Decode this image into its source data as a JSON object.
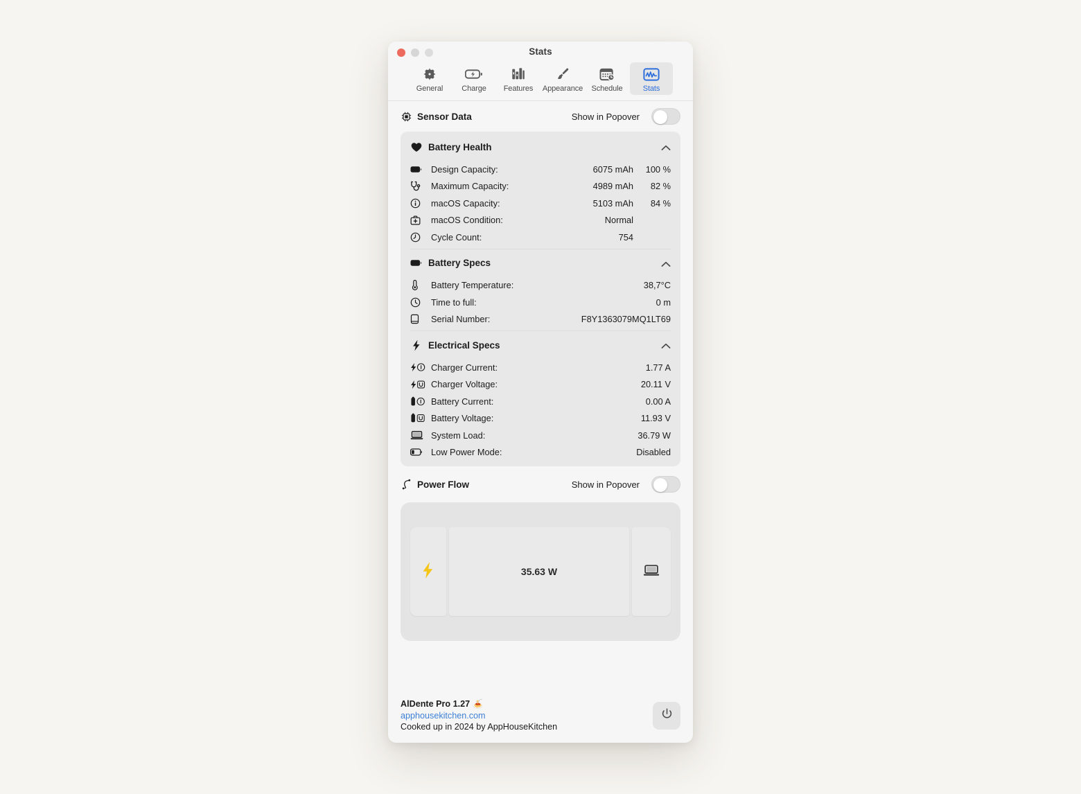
{
  "window": {
    "title": "Stats",
    "traffic_lights": [
      "close",
      "minimize",
      "zoom"
    ]
  },
  "toolbar": {
    "tabs": [
      {
        "label": "General",
        "icon": "gear-icon",
        "selected": false
      },
      {
        "label": "Charge",
        "icon": "battery-bolt-icon",
        "selected": false
      },
      {
        "label": "Features",
        "icon": "books-icon",
        "selected": false
      },
      {
        "label": "Appearance",
        "icon": "paintbrush-icon",
        "selected": false
      },
      {
        "label": "Schedule",
        "icon": "calendar-clock-icon",
        "selected": false
      },
      {
        "label": "Stats",
        "icon": "chart-waveform-icon",
        "selected": true
      }
    ],
    "accent_color": "#2f6fdd",
    "selected_tab_bg": "#e6e6e6"
  },
  "sensor_data": {
    "title": "Sensor Data",
    "icon": "chip-icon",
    "popover_label": "Show in Popover",
    "popover_enabled": false,
    "groups": [
      {
        "title": "Battery Health",
        "icon": "heart-icon",
        "expanded": true,
        "rows": [
          {
            "icon": "battery-full-icon",
            "label": "Design Capacity:",
            "value": "6075 mAh",
            "value2": "100 %"
          },
          {
            "icon": "stethoscope-icon",
            "label": "Maximum Capacity:",
            "value": "4989 mAh",
            "value2": "82 %"
          },
          {
            "icon": "info-circle-icon",
            "label": "macOS Capacity:",
            "value": "5103 mAh",
            "value2": "84 %"
          },
          {
            "icon": "first-aid-icon",
            "label": "macOS Condition:",
            "value": "Normal",
            "value2": ""
          },
          {
            "icon": "clock-icon",
            "label": "Cycle Count:",
            "value": "754",
            "value2": ""
          }
        ]
      },
      {
        "title": "Battery Specs",
        "icon": "battery-full-icon",
        "expanded": true,
        "rows": [
          {
            "icon": "thermometer-icon",
            "label": "Battery Temperature:",
            "value": "38,7°C",
            "value2": ""
          },
          {
            "icon": "clock-icon",
            "label": "Time to full:",
            "value": "0 m",
            "value2": ""
          },
          {
            "icon": "document-icon",
            "label": "Serial Number:",
            "value": "F8Y1363079MQ1LT69",
            "value2": ""
          }
        ]
      },
      {
        "title": "Electrical Specs",
        "icon": "bolt-icon",
        "expanded": true,
        "rows": [
          {
            "icon": "bolt-current-icon",
            "label": "Charger Current:",
            "value": "1.77 A",
            "value2": ""
          },
          {
            "icon": "bolt-voltage-icon",
            "label": "Charger Voltage:",
            "value": "20.11 V",
            "value2": ""
          },
          {
            "icon": "battery-current-icon",
            "label": "Battery Current:",
            "value": "0.00 A",
            "value2": ""
          },
          {
            "icon": "battery-voltage-icon",
            "label": "Battery Voltage:",
            "value": "11.93 V",
            "value2": ""
          },
          {
            "icon": "laptop-icon",
            "label": "System Load:",
            "value": "36.79 W",
            "value2": ""
          },
          {
            "icon": "battery-low-icon",
            "label": "Low Power Mode:",
            "value": "Disabled",
            "value2": ""
          }
        ]
      }
    ]
  },
  "power_flow": {
    "title": "Power Flow",
    "icon": "flow-path-icon",
    "popover_label": "Show in Popover",
    "popover_enabled": false,
    "source_icon": "lightning-bolt-icon",
    "source_icon_color": "#f5c518",
    "wattage": "35.63 W",
    "target_icon": "laptop-icon"
  },
  "footer": {
    "app_title": "AlDente Pro 1.27",
    "app_emoji": "🍝",
    "link": "apphousekitchen.com",
    "credit": "Cooked up in 2024 by AppHouseKitchen",
    "power_button_icon": "power-icon"
  }
}
